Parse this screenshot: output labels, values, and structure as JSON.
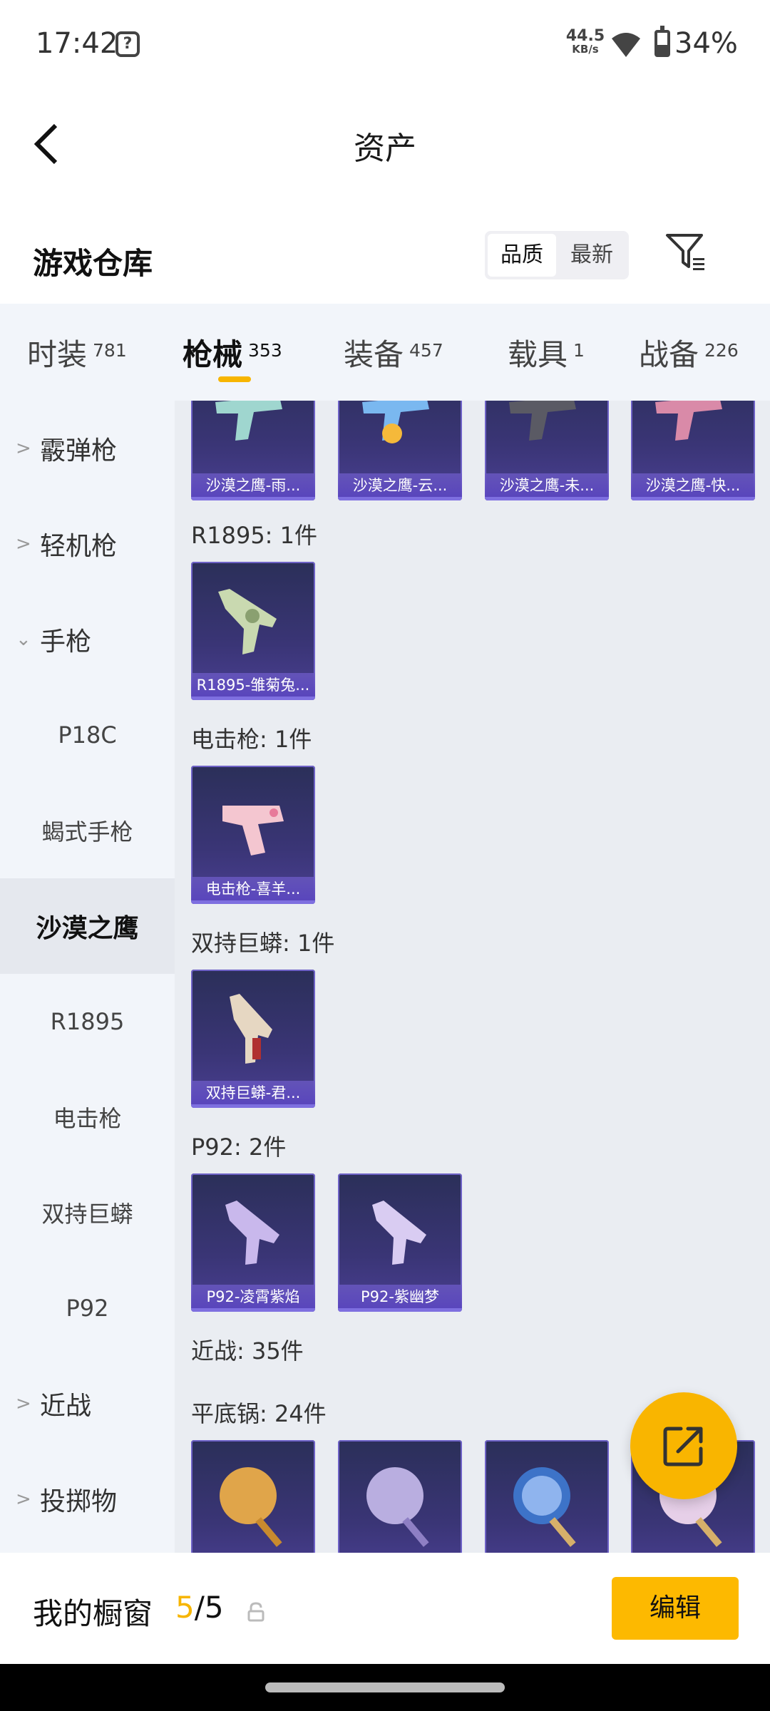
{
  "status_bar": {
    "time": "17:42",
    "net_speed": "44.5",
    "net_unit": "KB/s",
    "battery": "34%"
  },
  "header": {
    "title": "资产"
  },
  "warehouse": {
    "title": "游戏仓库",
    "sort_options": [
      "品质",
      "最新"
    ],
    "selected_sort": "品质"
  },
  "tabs": [
    {
      "label": "时装",
      "count": "781"
    },
    {
      "label": "枪械",
      "count": "353"
    },
    {
      "label": "装备",
      "count": "457"
    },
    {
      "label": "载具",
      "count": "1"
    },
    {
      "label": "战备",
      "count": "226"
    }
  ],
  "active_tab": "枪械",
  "sidebar": {
    "items": [
      {
        "label": "霰弹枪",
        "type": "category",
        "expanded": false
      },
      {
        "label": "轻机枪",
        "type": "category",
        "expanded": false
      },
      {
        "label": "手枪",
        "type": "category",
        "expanded": true
      },
      {
        "label": "P18C",
        "type": "sub"
      },
      {
        "label": "蝎式手枪",
        "type": "sub"
      },
      {
        "label": "沙漠之鹰",
        "type": "sub",
        "selected": true
      },
      {
        "label": "R1895",
        "type": "sub"
      },
      {
        "label": "电击枪",
        "type": "sub"
      },
      {
        "label": "双持巨蟒",
        "type": "sub"
      },
      {
        "label": "P92",
        "type": "sub"
      },
      {
        "label": "近战",
        "type": "category",
        "expanded": false
      },
      {
        "label": "投掷物",
        "type": "category",
        "expanded": false
      }
    ]
  },
  "sections": [
    {
      "title": "",
      "items": [
        "沙漠之鹰-雨...",
        "沙漠之鹰-云...",
        "沙漠之鹰-未...",
        "沙漠之鹰-快..."
      ]
    },
    {
      "title": "R1895: 1件",
      "items": [
        "R1895-雏菊兔..."
      ]
    },
    {
      "title": "电击枪: 1件",
      "items": [
        "电击枪-喜羊..."
      ]
    },
    {
      "title": "双持巨蟒: 1件",
      "items": [
        "双持巨蟒-君..."
      ]
    },
    {
      "title": "P92: 2件",
      "items": [
        "P92-凌霄紫焰",
        "P92-紫幽梦"
      ]
    },
    {
      "title": "近战: 35件",
      "items": []
    },
    {
      "title": "平底锅: 24件",
      "items": [
        "",
        "",
        "",
        ""
      ]
    }
  ],
  "showcase": {
    "label": "我的橱窗",
    "current": "5",
    "separator": "/",
    "total": "5",
    "edit_label": "编辑"
  },
  "icons": [
    "question-icon",
    "wifi-icon",
    "battery-icon",
    "back-icon",
    "filter-icon",
    "share-icon",
    "lock-icon",
    "chevron-right-icon",
    "chevron-down-icon"
  ],
  "colors": {
    "accent": "#f7b500",
    "card_purple": "#3a3576"
  }
}
